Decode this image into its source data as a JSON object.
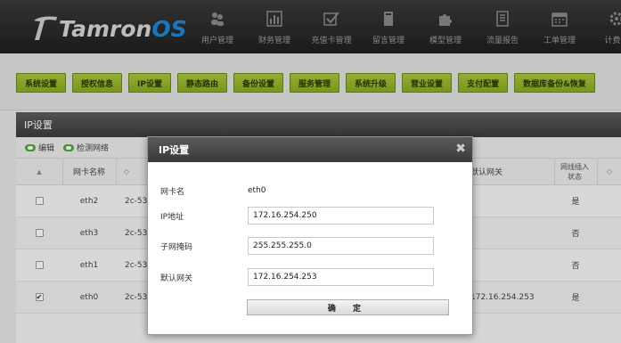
{
  "app": {
    "logo_main": "Tamron",
    "logo_os": "OS"
  },
  "nav": [
    {
      "label": "用户管理",
      "icon": "users-icon"
    },
    {
      "label": "财务管理",
      "icon": "chart-icon"
    },
    {
      "label": "充值卡管理",
      "icon": "checkbox-icon"
    },
    {
      "label": "留言管理",
      "icon": "book-icon"
    },
    {
      "label": "模型管理",
      "icon": "puzzle-icon"
    },
    {
      "label": "流量报告",
      "icon": "report-icon"
    },
    {
      "label": "工单管理",
      "icon": "calendar-icon"
    },
    {
      "label": "计费设",
      "icon": "settings-icon"
    }
  ],
  "toolbar": [
    "系统设置",
    "授权信息",
    "IP设置",
    "静态路由",
    "备份设置",
    "服务管理",
    "系统升级",
    "营业设置",
    "支付配置",
    "数据库备份&恢复"
  ],
  "panel": {
    "title": "IP设置",
    "tool_edit": "编辑",
    "tool_check": "检测网络"
  },
  "table": {
    "headers": {
      "sort": "▲",
      "name": "网卡名称",
      "mac_sort": "◇",
      "gateway": "默认网关",
      "status": "网线插入状态",
      "status_sort": "◇"
    },
    "rows": [
      {
        "checked": false,
        "name": "eth2",
        "mac": "2c-53",
        "gateway": "",
        "status": "是"
      },
      {
        "checked": false,
        "name": "eth3",
        "mac": "2c-53",
        "gateway": "",
        "status": "否"
      },
      {
        "checked": false,
        "name": "eth1",
        "mac": "2c-53",
        "gateway": "",
        "status": "否"
      },
      {
        "checked": true,
        "name": "eth0",
        "mac": "2c-53",
        "gateway": "172.16.254.253",
        "status": "是"
      }
    ]
  },
  "modal": {
    "title": "IP设置",
    "close": "✖",
    "nic_label": "网卡名",
    "nic_value": "eth0",
    "ip_label": "IP地址",
    "ip_value": "172.16.254.250",
    "mask_label": "子网掩码",
    "mask_value": "255.255.255.0",
    "gw_label": "默认网关",
    "gw_value": "172.16.254.253",
    "ok": "确 定"
  }
}
